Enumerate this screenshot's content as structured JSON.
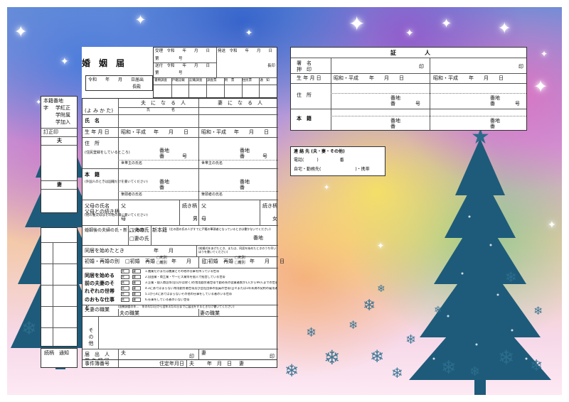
{
  "registry": {
    "title": "婚　姻　届",
    "date": "令和　　年　　月　　日届出",
    "addressee": "長殿",
    "receipt": {
      "accepted": "受理　令和　　年　　月　　日",
      "sent": "発送　令和　　年　　月　　日",
      "received": "送付　令和　　年　　月　　日",
      "no1": "第　　　　　号",
      "no2": "第　　　　　号",
      "chief": "長印",
      "columns": [
        "書類調査",
        "戸籍記載",
        "記載調査",
        "調査票",
        "附　票",
        "住民票",
        "通　知"
      ]
    },
    "columns": {
      "husband": "夫　に　な　る　人",
      "wife": "妻　に　な　る　人"
    },
    "rows": {
      "furigana": "(よ み か た)",
      "name": "氏　名",
      "birth": "生 年 月 日",
      "address": "住　所",
      "address_note": "(住民登録をしているところ)",
      "honseki": "本　籍",
      "honseki_note": "(外国人のときは国籍だけを書いてください)",
      "parents": "父母の氏名\n父母との続き柄",
      "parents_note": "(他の養父母はその他の欄に書いてください)",
      "surname": "婚姻後の夫婦の氏・新しい本籍",
      "first_cohabit": "同居を始めたとき",
      "previous": "初婚・再婚の別",
      "occupation_intro": "同居を始める前の夫妻のそれぞれの世帯のおもな仕事と",
      "occupation": "夫妻の職業",
      "other": "そ の 他",
      "signature": "届　出　人\n署 名 押 印",
      "case_no": "事件簿番号"
    },
    "labels": {
      "showa_heisei": "昭和・平成",
      "ymd": "年　　月　　日",
      "banchi": "番地",
      "ban": "番",
      "go": "号",
      "head": "世帯主の氏名",
      "head2": "筆頭者の氏名",
      "father": "父",
      "mother": "母",
      "relation": "続き柄",
      "son": "男",
      "daughter": "女",
      "husband_surname": "□夫の氏",
      "wife_surname": "□妻の氏",
      "new_honseki": "新本籍",
      "new_honseki_note": "(左の囲の氏の人がすでに戸籍の筆頭者となっているときは書かないでください)",
      "cohabit_date": "年　　月",
      "cohabit_note": "(結婚式をあげたとき、または、同居を始めたときのうち早いほうを書いてください)",
      "first": "□初婚",
      "re": "再婚",
      "death": "□死別",
      "divorce": "□離別",
      "husband_occ": "夫の職業",
      "wife_occ": "妻の職業",
      "occ_note": "(国勢調査の年…　年の4月1日から翌年3月31日までに届出をするときだけ書いてください)",
      "seal": "印",
      "husband": "夫",
      "wife": "妻",
      "tel": "住定年月日",
      "chou": "年　月　日"
    },
    "occupations": [
      "1.農業だけまたは農業とその他の仕事を持っている世帯",
      "2.自由業・商工業・サービス業等を個人で経営している世帯",
      "3.企業・個人商店等(官公庁は除く)の常用勤労者世帯で勤め先の従業者数が1人から99人までの世帯(日々または1年未満の契約の雇用者は5)",
      "4.3にあてはまらない常用勤労者世帯及び会社団体の役員の世帯(日々または1年未満の契約の雇用者は5)",
      "5.1から4にあてはまらないその他の仕事をしている者のいる世帯",
      "6.仕事をしている者のいない世帯"
    ]
  },
  "witness": {
    "title": "証　　　　　人",
    "sign": "署　名\n押　印",
    "birth": "生 年 月 日",
    "address": "住　所",
    "honseki": "本　籍",
    "seal": "印",
    "showa": "昭和・平成",
    "ymd": "年　　月　　日",
    "banchi": "番地",
    "ban": "番",
    "go": "号"
  },
  "contact": {
    "title": "連 絡 先 (夫・妻・その他)",
    "phone": "電話(　　　)　　　　　番",
    "home": "自宅・勤務先(　　　　　　　　)・携帯"
  },
  "left_panel": {
    "items": [
      "本籍番地",
      "字",
      "学紅正",
      "学附属",
      "学加入",
      "訂正印"
    ],
    "husband": "夫",
    "wife": "妻",
    "relation_tab": "続柄　通知"
  }
}
